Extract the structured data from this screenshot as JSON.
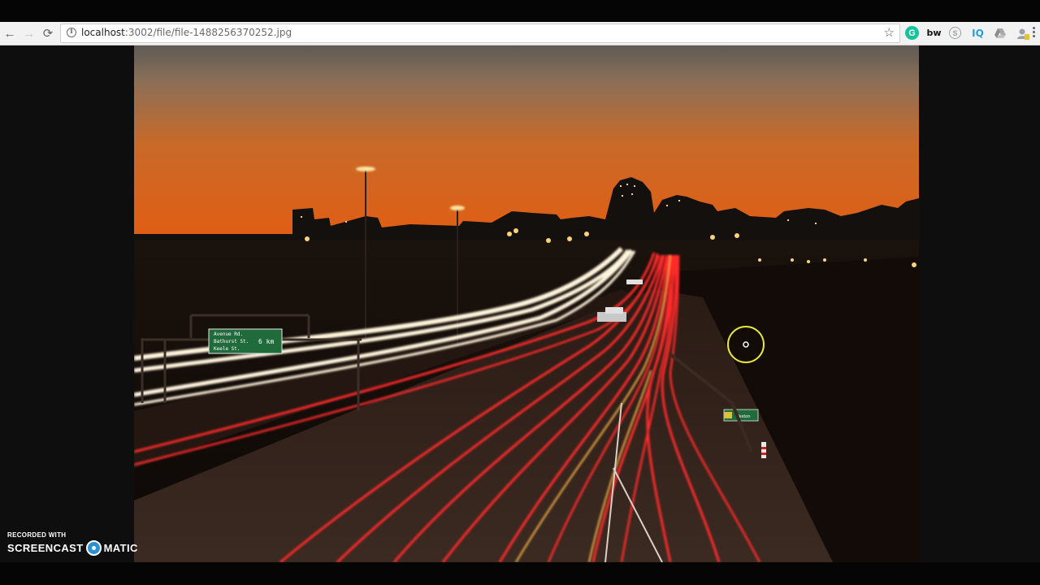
{
  "browser": {
    "nav": {
      "back_icon": "back-arrow-icon",
      "forward_icon": "forward-arrow-icon",
      "reload_icon": "reload-icon",
      "back_glyph": "←",
      "forward_glyph": "→",
      "reload_glyph": "⟳"
    },
    "address_bar": {
      "host": "localhost",
      "path": ":3002/file/file-1488256370252.jpg",
      "info_glyph": "i",
      "star_glyph": "☆"
    },
    "extensions": [
      {
        "name": "grammarly-icon",
        "glyph": "G",
        "color": "#15c39a"
      },
      {
        "name": "bitwarden-icon",
        "glyph": "bw",
        "color": "#111111"
      },
      {
        "name": "skype-icon",
        "glyph": "S",
        "color": "#9aa0a6"
      },
      {
        "name": "iq-icon",
        "glyph": "IQ",
        "color": "#2a9fd6"
      },
      {
        "name": "drive-icon",
        "glyph": "",
        "color": "#9aa0a6"
      },
      {
        "name": "user-badge-icon",
        "glyph": "",
        "color": "#9aa0a6"
      }
    ]
  },
  "content": {
    "image_name": "file-1488256370252.jpg",
    "sign_left": {
      "line1": "Avenue Rd.",
      "line2": "Bathurst St.",
      "line3": "Keele St.",
      "distance": "6 km"
    },
    "sign_right": {
      "label": "Weston"
    }
  },
  "watermark": {
    "top": "RECORDED WITH",
    "left": "SCREENCAST",
    "right": "MATIC"
  },
  "colors": {
    "chrome_bg": "#f2f2f2",
    "sky_top": "#6b6660",
    "sky_bottom": "#e86a16",
    "trail_red": "#ff2a2a",
    "trail_white": "#fff4dc",
    "cursor_ring": "#e8e83a"
  }
}
